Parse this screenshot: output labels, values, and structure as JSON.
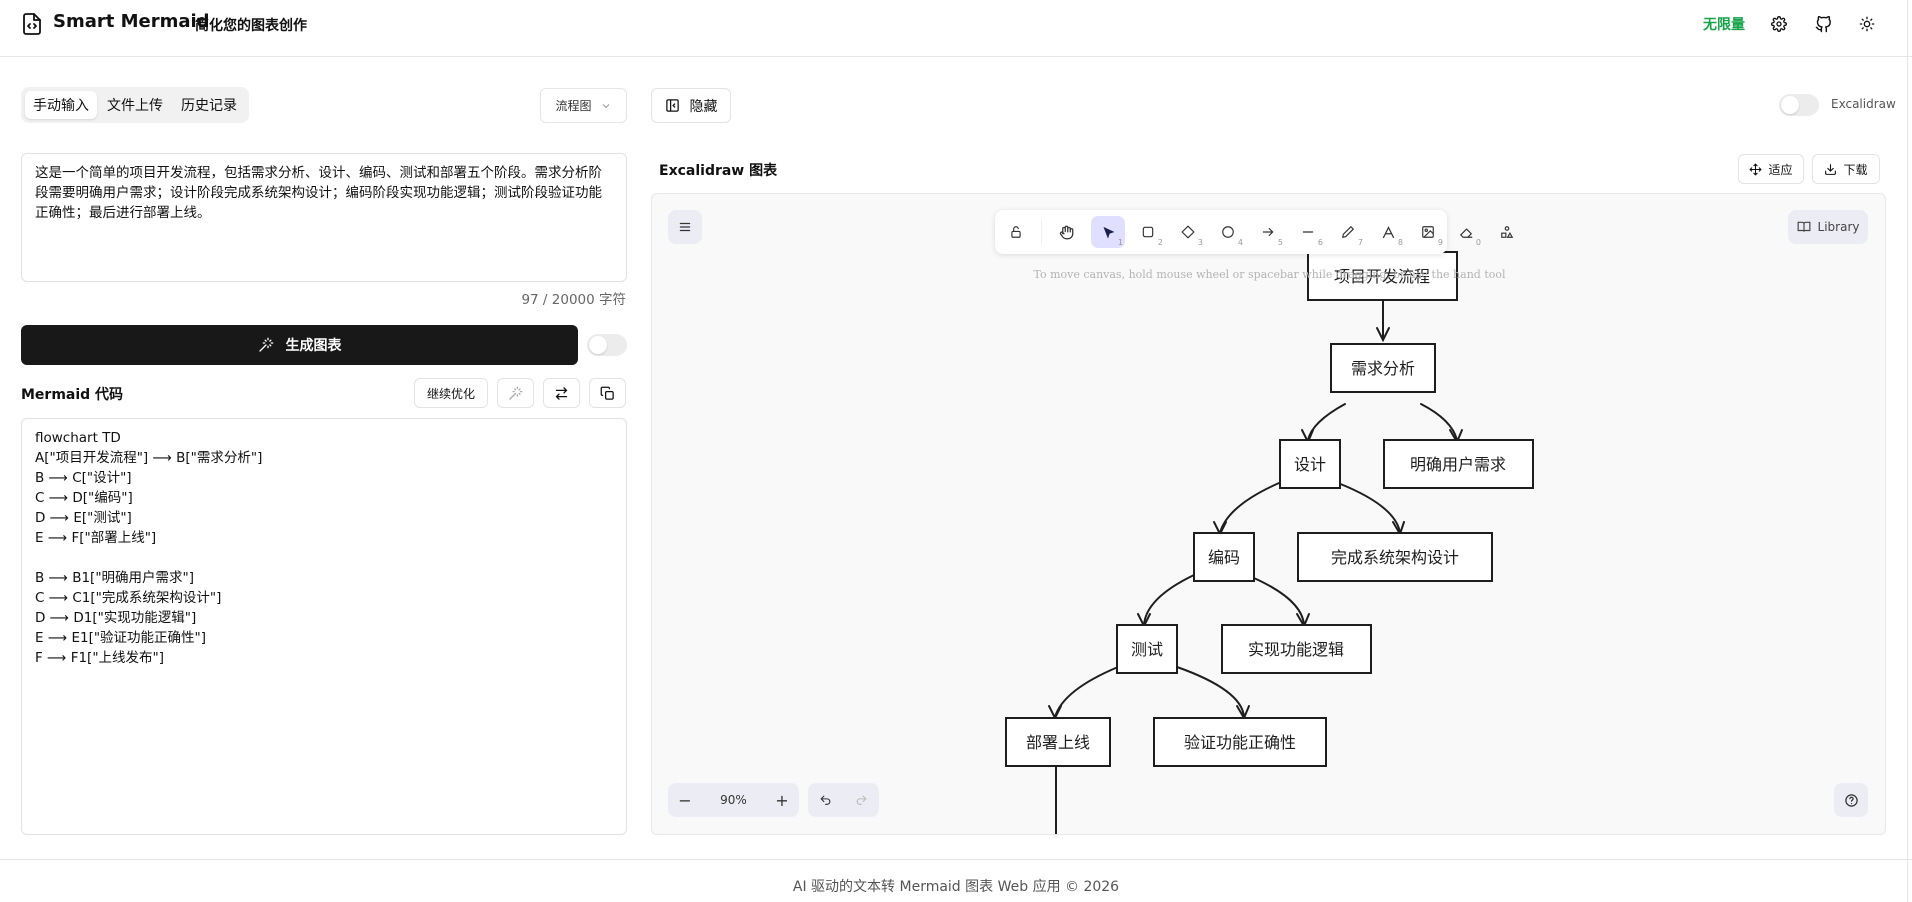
{
  "header": {
    "brand": "Smart Mermaid",
    "tagline": "简化您的图表创作",
    "plan_badge": "无限量",
    "icons": [
      "settings-icon",
      "github-icon",
      "sun-icon"
    ]
  },
  "input": {
    "tabs": [
      "手动输入",
      "文件上传",
      "历史记录"
    ],
    "active_tab": "手动输入",
    "diagram_type": "流程图",
    "text": "这是一个简单的项目开发流程，包括需求分析、设计、编码、测试和部署五个阶段。需求分析阶段需要明确用户需求；设计阶段完成系统架构设计；编码阶段实现功能逻辑；测试阶段验证功能正确性；最后进行部署上线。",
    "counter": "97 / 20000 字符",
    "generate_label": "生成图表"
  },
  "code_panel": {
    "title": "Mermaid 代码",
    "optimize_label": "继续优化",
    "lines": [
      "flowchart TD",
      "A[\"项目开发流程\"] ⟶ B[\"需求分析\"]",
      "B ⟶ C[\"设计\"]",
      "C ⟶ D[\"编码\"]",
      "D ⟶ E[\"测试\"]",
      "E ⟶ F[\"部署上线\"]",
      "",
      "B ⟶ B1[\"明确用户需求\"]",
      "C ⟶ C1[\"完成系统架构设计\"]",
      "D ⟶ D1[\"实现功能逻辑\"]",
      "E ⟶ E1[\"验证功能正确性\"]",
      "F ⟶ F1[\"上线发布\"]"
    ]
  },
  "preview": {
    "hide_label": "隐藏",
    "excalidraw_toggle_label": "Excalidraw",
    "title": "Excalidraw 图表",
    "fit_label": "适应",
    "download_label": "下载",
    "library_label": "Library",
    "hint": "To move canvas, hold mouse wheel or spacebar while dragging, or use the hand tool",
    "zoom": "90%",
    "tools": [
      {
        "icon": "lock-icon",
        "key": ""
      },
      {
        "icon": "hand-icon",
        "key": ""
      },
      {
        "icon": "pointer-icon",
        "key": "1"
      },
      {
        "icon": "rectangle-icon",
        "key": "2"
      },
      {
        "icon": "diamond-icon",
        "key": "3"
      },
      {
        "icon": "ellipse-icon",
        "key": "4"
      },
      {
        "icon": "arrow-icon",
        "key": "5"
      },
      {
        "icon": "line-icon",
        "key": "6"
      },
      {
        "icon": "pencil-icon",
        "key": "7"
      },
      {
        "icon": "text-icon",
        "key": "8"
      },
      {
        "icon": "image-icon",
        "key": "9"
      },
      {
        "icon": "eraser-icon",
        "key": "0"
      },
      {
        "icon": "shapes-icon",
        "key": ""
      }
    ],
    "diagram_nodes": [
      "项目开发流程",
      "需求分析",
      "设计",
      "明确用户需求",
      "编码",
      "完成系统架构设计",
      "测试",
      "实现功能逻辑",
      "部署上线",
      "验证功能正确性"
    ]
  },
  "footer": {
    "text": "AI 驱动的文本转 Mermaid 图表 Web 应用 © 2026"
  }
}
